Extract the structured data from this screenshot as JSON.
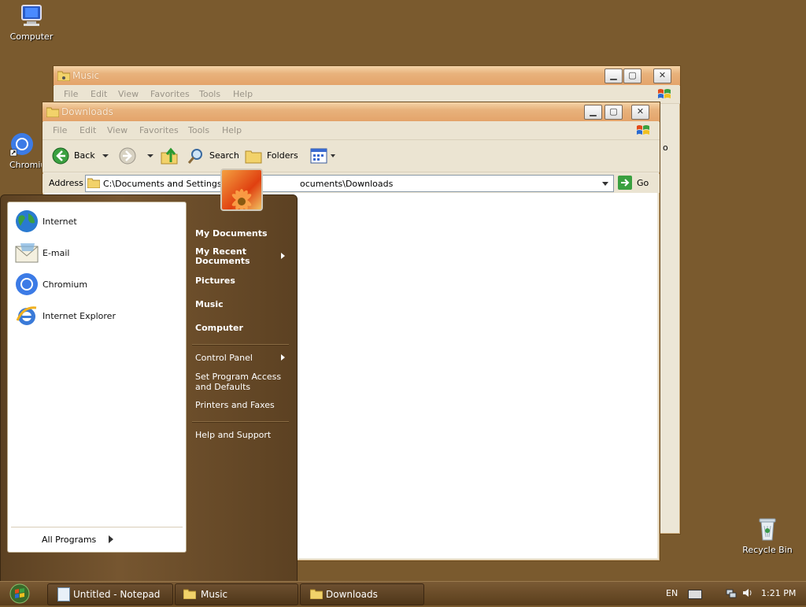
{
  "desktop": {
    "icons": {
      "computer": "Computer",
      "chromium": "Chromiu",
      "recycle_bin": "Recycle Bin"
    }
  },
  "music_window": {
    "title": "Music",
    "menu": [
      "File",
      "Edit",
      "View",
      "Favorites",
      "Tools",
      "Help"
    ],
    "go_fragment": "o"
  },
  "downloads_window": {
    "title": "Downloads",
    "menu": [
      "File",
      "Edit",
      "View",
      "Favorites",
      "Tools",
      "Help"
    ],
    "toolbar": {
      "back": "Back",
      "search": "Search",
      "folders": "Folders"
    },
    "address_label": "Address",
    "address_left": "C:\\Documents and Settings\\",
    "address_right": "ocuments\\Downloads",
    "go": "Go"
  },
  "start_menu": {
    "pinned": [
      "Internet",
      "E-mail",
      "Chromium",
      "Internet Explorer"
    ],
    "all_programs": "All Programs",
    "right": {
      "my_documents": "My Documents",
      "my_recent_documents": "My Recent Documents",
      "pictures": "Pictures",
      "music": "Music",
      "computer": "Computer",
      "control_panel": "Control Panel",
      "set_program_access": "Set Program Access and Defaults",
      "printers_and_faxes": "Printers and Faxes",
      "help_and_support": "Help and Support"
    }
  },
  "taskbar": {
    "items": [
      "Untitled - Notepad",
      "Music",
      "Downloads"
    ],
    "language": "EN",
    "clock": "1:21 PM"
  },
  "colors": {
    "desktop": "#7a5a2e",
    "titlebar": "#e4a46a",
    "startmenu": "#765630",
    "taskbar": "#5a3e1c"
  }
}
